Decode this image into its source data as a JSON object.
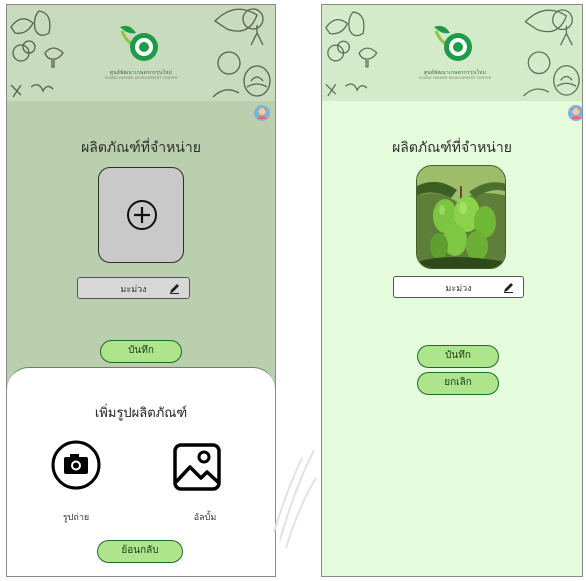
{
  "colors": {
    "left_bg": "#b9cfae",
    "right_bg": "#e4fbdc",
    "button_fill": "#aee48b",
    "button_border": "#1f6b2d",
    "logo_green": "#1e9b47"
  },
  "brand": {
    "name": "ศูนย์พัฒนาเกษตรกรรุ่นใหม่",
    "name_en": "YOUNG FARMER DEVELOPMENT CENTER"
  },
  "left_screen": {
    "title": "ผลิตภัณฑ์ที่จำหน่าย",
    "add_photo_icon": "plus-circle-icon",
    "product_name": "มะม่วง",
    "save_label": "บันทึก",
    "sheet": {
      "title": "เพิ่มรูปผลิตภัณฑ์",
      "camera_label": "รูปถ่าย",
      "camera_icon": "camera-icon",
      "album_label": "อัลบั้ม",
      "album_icon": "gallery-icon",
      "back_label": "ย้อนกลับ"
    }
  },
  "right_screen": {
    "title": "ผลิตภัณฑ์ที่จำหน่าย",
    "photo_subject": "mango-photo",
    "product_name": "มะม่วง",
    "save_label": "บันทึก",
    "cancel_label": "ยกเลิก"
  }
}
